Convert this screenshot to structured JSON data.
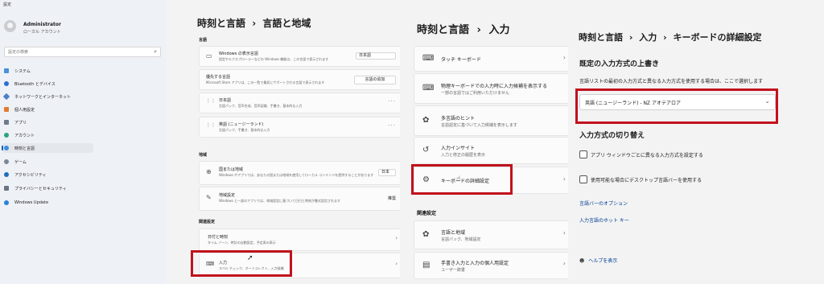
{
  "sidebar": {
    "window_title": "設定",
    "user_name": "Administrator",
    "user_role": "ローカル アカウント",
    "search_placeholder": "設定の検索",
    "items": [
      {
        "label": "システム",
        "color": "#4a8fd8"
      },
      {
        "label": "Bluetooth とデバイス",
        "color": "#2b6fd3"
      },
      {
        "label": "ネットワークとインターネット",
        "color": "#4f7dc9"
      },
      {
        "label": "個人用設定",
        "color": "#e07b32"
      },
      {
        "label": "アプリ",
        "color": "#6f7a8a"
      },
      {
        "label": "アカウント",
        "color": "#2aa37a"
      },
      {
        "label": "時刻と言語",
        "color": "#3c8ddc",
        "selected": true
      },
      {
        "label": "ゲーム",
        "color": "#7c8794"
      },
      {
        "label": "アクセシビリティ",
        "color": "#1f6fb8"
      },
      {
        "label": "プライバシーとセキュリティ",
        "color": "#6b7480"
      },
      {
        "label": "Windows Update",
        "color": "#2b82d9"
      }
    ]
  },
  "panel2": {
    "breadcrumb_parent": "時刻と言語",
    "breadcrumb_sep": "›",
    "breadcrumb_current": "言語と地域",
    "section_language": "言語",
    "display_language_title": "Windows の表示言語",
    "display_language_desc": "設定やエクスプローラーなどの Windows 機能は、この言語で表示されます",
    "display_language_value": "日本語",
    "preferred_title": "優先する言語",
    "preferred_desc": "Microsoft Store アプリは、この一覧で最初にサポートされる言語で表示されます",
    "preferred_button": "言語の追加",
    "lang1_title": "日本語",
    "lang1_desc": "言語パック、音声合成、音声認識、手書き、基本的な入力",
    "lang2_title": "英語 (ニュージーランド)",
    "lang2_desc": "言語パック、手書き、基本的な入力",
    "section_region": "地域",
    "country_title": "国または地域",
    "country_desc": "Windows やアプリでは、あなたの国または地域を使用してローカル コンテンツを提供することがあります",
    "country_value": "日本",
    "regional_title": "地域設定",
    "regional_desc": "Windows と一部のアプリでは、地域設定に基づいて日付と時刻が書式設定されます",
    "regional_value": "推奨",
    "section_related": "関連設定",
    "datetime_title": "日付と時刻",
    "datetime_desc": "タイム ゾーン、時計の自動設定、予定表の表示",
    "input_title": "入力",
    "input_desc": "スペル チェック、オートコレクト、入力候補"
  },
  "panel3": {
    "breadcrumb_parent": "時刻と言語",
    "breadcrumb_sep": "›",
    "breadcrumb_current": "入力",
    "touch_keyboard": "タッチ キーボード",
    "physical_title": "物理キーボードでの入力時に入力候補を表示する",
    "physical_desc": "一部の言語ではご利用いただけません",
    "multilang_title": "多言語のヒント",
    "multilang_desc": "言語認定に基づいて入力候補を表示します",
    "insights_title": "入力インサイト",
    "insights_desc": "入力と修正の履歴を表示",
    "advanced_keyboard": "キーボードの詳細設定",
    "section_related": "関連設定",
    "lang_region_title": "言語と地域",
    "lang_region_desc": "言語パック、地域設定",
    "handwriting_title": "手書き入力と入力の個人用設定",
    "handwriting_desc": "ユーザー辞書"
  },
  "panel4": {
    "breadcrumb_1": "時刻と言語",
    "breadcrumb_2": "入力",
    "breadcrumb_3": "キーボードの詳細設定",
    "breadcrumb_sep": "›",
    "override_title": "既定の入力方式の上書き",
    "override_desc": "言語リストの最初の入力方式と異なる入力方式を使用する場合は、ここで選択します",
    "dropdown_value": "英語 (ニュージーランド) - NZ アオテアロア",
    "switch_title": "入力方式の切り替え",
    "checkbox1": "アプリ ウィンドウごとに異なる入力方式を設定する",
    "checkbox2": "使用可能な場合にデスクトップ言語バーを使用する",
    "link_language_bar": "言語バーのオプション",
    "link_hotkeys": "入力言語のホット キー",
    "help": "ヘルプを表示"
  },
  "accent": {
    "highlight": "#c1121c",
    "link": "#003e92"
  }
}
